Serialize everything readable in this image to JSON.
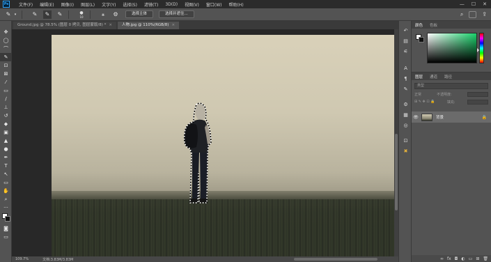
{
  "menubar": {
    "logo": "Ps",
    "items": [
      "文件(F)",
      "编辑(E)",
      "图像(I)",
      "图层(L)",
      "文字(Y)",
      "选择(S)",
      "滤镜(T)",
      "3D(D)",
      "视图(V)",
      "窗口(W)",
      "帮助(H)"
    ],
    "minimize": "—",
    "maximize": "☐",
    "close": "✕"
  },
  "options": {
    "brush_size": "10",
    "select_subject_label": "选择主体",
    "select_mask_label": "选择并遮住..."
  },
  "tabs": [
    {
      "label": "Ground.jpg @ 78.5% (图层 0 拷贝, 图层蒙版/8) *",
      "close": "×"
    },
    {
      "label": "人物.jpg @ 110%(RGB/8)",
      "close": "×"
    }
  ],
  "status": {
    "zoom": "109.7%",
    "doc": "文档:3.83M/3.83M"
  },
  "panels": {
    "color_tabs": [
      "颜色",
      "色板"
    ],
    "layers_tabs": [
      "图层",
      "通道",
      "路径"
    ],
    "layer_kind": "类型",
    "blend_mode": "正常",
    "opacity_label": "不透明度:",
    "fill_label": "填充:",
    "layer": {
      "name": "背景",
      "eye": "👁",
      "lock": "🔒"
    }
  },
  "colors": {
    "foreground": "#ffffff",
    "background": "#111111",
    "accent": "#31a8ff",
    "picked_hue": "#19d36b"
  }
}
